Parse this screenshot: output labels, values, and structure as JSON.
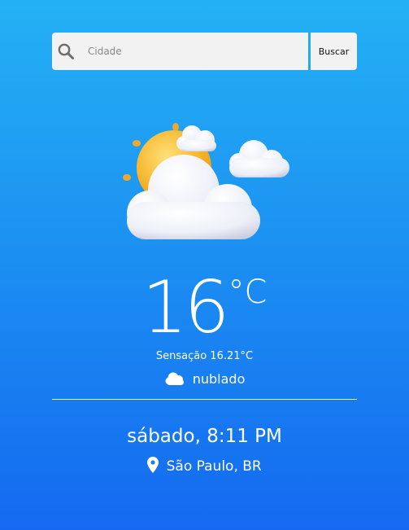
{
  "search": {
    "placeholder": "Cidade",
    "value": "",
    "button_label": "Buscar",
    "icon": "search-icon"
  },
  "weather": {
    "illustration_icon": "sun-behind-clouds-icon",
    "temperature": "16",
    "unit": "°C",
    "feels_like": "Sensação 16.21°C",
    "condition_icon": "cloud-icon",
    "condition": "nublado"
  },
  "datetime": {
    "text": "sábado, 8:11 PM"
  },
  "location": {
    "icon": "location-pin-icon",
    "text": "São Paulo, BR"
  },
  "colors": {
    "background_top": "#24b1f4",
    "background_bottom": "#1469f0",
    "sun": "#f5b82e",
    "input_background": "#f2f2f2"
  }
}
